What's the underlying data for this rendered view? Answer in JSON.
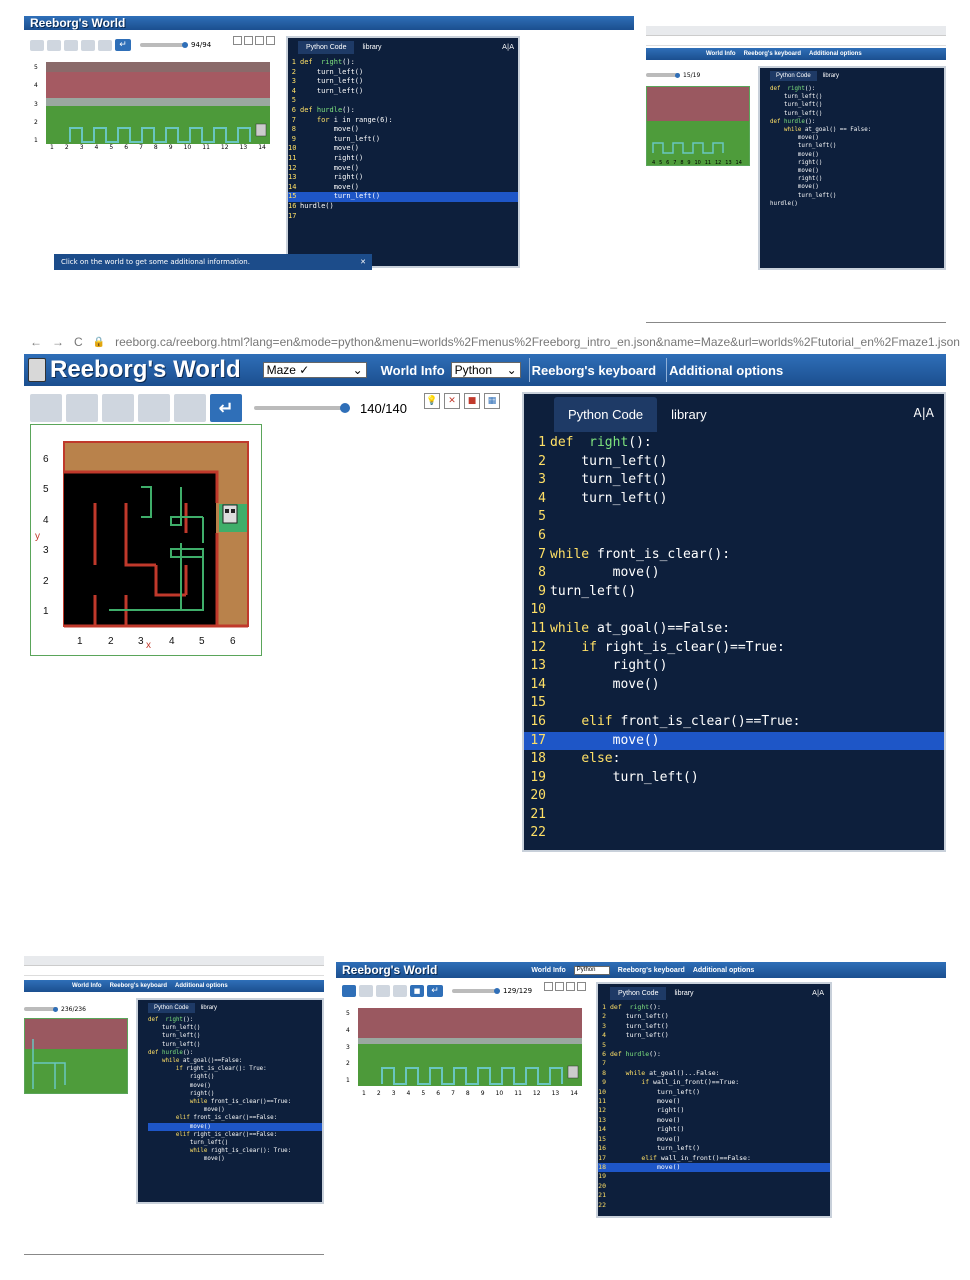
{
  "top_left": {
    "brand": "Reeborg's World",
    "speed_value": "94/94",
    "editor_tabs": [
      "Python Code",
      "library"
    ],
    "font_toggle": "A|A",
    "code": [
      {
        "n": "1",
        "t": "def  right():"
      },
      {
        "n": "2",
        "t": "    turn_left()"
      },
      {
        "n": "3",
        "t": "    turn_left()"
      },
      {
        "n": "4",
        "t": "    turn_left()"
      },
      {
        "n": "5",
        "t": ""
      },
      {
        "n": "6",
        "t": "def hurdle():"
      },
      {
        "n": "7",
        "t": "    for i in range(6):"
      },
      {
        "n": "8",
        "t": "        move()"
      },
      {
        "n": "9",
        "t": "        turn_left()"
      },
      {
        "n": "10",
        "t": "        move()"
      },
      {
        "n": "11",
        "t": "        right()"
      },
      {
        "n": "12",
        "t": "        move()"
      },
      {
        "n": "13",
        "t": "        right()"
      },
      {
        "n": "14",
        "t": "        move()"
      },
      {
        "n": "15",
        "t": "        turn_left()"
      },
      {
        "n": "16",
        "t": "hurdle()"
      },
      {
        "n": "17",
        "t": ""
      }
    ],
    "highlight_line": 15,
    "x_ticks": [
      "1",
      "2",
      "3",
      "4",
      "5",
      "6",
      "7",
      "8",
      "9",
      "10",
      "11",
      "12",
      "13",
      "14"
    ],
    "y_ticks": [
      "5",
      "4",
      "3",
      "2",
      "1"
    ],
    "info_banner": "Click on the world to get some additional information."
  },
  "top_right": {
    "speed_value": "15/19",
    "menu_items": [
      "World Info",
      "Reeborg's keyboard",
      "Additional options"
    ],
    "editor_tabs": [
      "Python Code",
      "library"
    ],
    "code": [
      "def  right():",
      "    turn_left()",
      "    turn_left()",
      "    turn_left()",
      "",
      "def hurdle():",
      "",
      "    while at_goal() == False:",
      "        move()",
      "        turn_left()",
      "        move()",
      "        right()",
      "        move()",
      "        right()",
      "        move()",
      "        turn_left()",
      "hurdle()"
    ],
    "x_ticks": [
      "4",
      "5",
      "6",
      "7",
      "8",
      "9",
      "10",
      "11",
      "12",
      "13",
      "14"
    ]
  },
  "main": {
    "nav_back": "←",
    "nav_forward": "→",
    "nav_reload": "C",
    "url": "reeborg.ca/reeborg.html?lang=en&mode=python&menu=worlds%2Fmenus%2Freeborg_intro_en.json&name=Maze&url=worlds%2Ftutorial_en%2Fmaze1.json",
    "brand": "Reeborg's World",
    "world_select": "Maze ✓",
    "world_info": "World Info",
    "language_select": "Python",
    "keyboard": "Reeborg's keyboard",
    "additional_options": "Additional options",
    "enter_icon": "↵",
    "speed_value": "140/140",
    "tabs": [
      "Python Code",
      "library"
    ],
    "font_toggle": "A|A",
    "x_ticks": [
      "1",
      "2",
      "3",
      "4",
      "5",
      "6"
    ],
    "y_ticks": [
      "6",
      "5",
      "4",
      "3",
      "2",
      "1"
    ],
    "x_axis_label": "x",
    "y_axis_label": "y",
    "code": [
      {
        "n": "1",
        "t": "def  right():"
      },
      {
        "n": "2",
        "t": "    turn_left()"
      },
      {
        "n": "3",
        "t": "    turn_left()"
      },
      {
        "n": "4",
        "t": "    turn_left()"
      },
      {
        "n": "5",
        "t": ""
      },
      {
        "n": "6",
        "t": ""
      },
      {
        "n": "7",
        "t": "while front_is_clear():"
      },
      {
        "n": "8",
        "t": "        move()"
      },
      {
        "n": "9",
        "t": "turn_left()"
      },
      {
        "n": "10",
        "t": ""
      },
      {
        "n": "11",
        "t": "while at_goal()==False:"
      },
      {
        "n": "12",
        "t": "    if right_is_clear()==True:"
      },
      {
        "n": "13",
        "t": "        right()"
      },
      {
        "n": "14",
        "t": "        move()"
      },
      {
        "n": "15",
        "t": ""
      },
      {
        "n": "16",
        "t": "    elif front_is_clear()==True:"
      },
      {
        "n": "17",
        "t": "        move()"
      },
      {
        "n": "18",
        "t": "    else:"
      },
      {
        "n": "19",
        "t": "        turn_left()"
      },
      {
        "n": "20",
        "t": ""
      },
      {
        "n": "21",
        "t": ""
      },
      {
        "n": "22",
        "t": ""
      }
    ],
    "highlight_line": 17
  },
  "bottom_left": {
    "speed_value": "236/236",
    "menu_items": [
      "World Info",
      "Reeborg's keyboard",
      "Additional options"
    ],
    "editor_tabs": [
      "Python Code",
      "library"
    ],
    "code": [
      "def  right():",
      "    turn_left()",
      "    turn_left()",
      "    turn_left()",
      "",
      "def hurdle():",
      "",
      "    while at_goal()==False:",
      "        if right_is_clear(): True:",
      "            right()",
      "            move()",
      "            right()",
      "            while front_is_clear()==True:",
      "                move()",
      "        elif front_is_clear()==False:",
      "            move()",
      "        elif right_is_clear()==False:",
      "            turn_left()",
      "            while right_is_clear(): True:",
      "                move()"
    ],
    "highlight_line": 16
  },
  "bottom_right": {
    "brand": "Reeborg's World",
    "menu_items": [
      "World Info",
      "Python",
      "Reeborg's keyboard",
      "Additional options"
    ],
    "speed_value": "129/129",
    "editor_tabs": [
      "Python Code",
      "library"
    ],
    "font_toggle": "A|A",
    "code": [
      {
        "n": "1",
        "t": "def  right():"
      },
      {
        "n": "2",
        "t": "    turn_left()"
      },
      {
        "n": "3",
        "t": "    turn_left()"
      },
      {
        "n": "4",
        "t": "    turn_left()"
      },
      {
        "n": "5",
        "t": ""
      },
      {
        "n": "6",
        "t": "def hurdle():"
      },
      {
        "n": "7",
        "t": ""
      },
      {
        "n": "8",
        "t": "    while at_goal()...False:"
      },
      {
        "n": "9",
        "t": "        if wall_in_front()==True:"
      },
      {
        "n": "10",
        "t": "            turn_left()"
      },
      {
        "n": "11",
        "t": "            move()"
      },
      {
        "n": "12",
        "t": "            right()"
      },
      {
        "n": "13",
        "t": "            move()"
      },
      {
        "n": "14",
        "t": "            right()"
      },
      {
        "n": "15",
        "t": "            move()"
      },
      {
        "n": "16",
        "t": "            turn_left()"
      },
      {
        "n": "17",
        "t": "        elif wall_in_front()==False:"
      },
      {
        "n": "18",
        "t": "            move()"
      },
      {
        "n": "19",
        "t": ""
      },
      {
        "n": "20",
        "t": ""
      },
      {
        "n": "21",
        "t": ""
      },
      {
        "n": "22",
        "t": ""
      }
    ],
    "highlight_line": 18,
    "x_ticks": [
      "1",
      "2",
      "3",
      "4",
      "5",
      "6",
      "7",
      "8",
      "9",
      "10",
      "11",
      "12",
      "13",
      "14"
    ],
    "y_ticks": [
      "5",
      "4",
      "3",
      "2",
      "1"
    ]
  },
  "colors": {
    "topbar": "#2f6fb8",
    "editor_bg": "#0d1f3c",
    "highlight": "#1e56c7",
    "keyword": "#ffe066",
    "function_name": "#7ee37e",
    "wall": "#c0392b",
    "path": "#3fae6a",
    "sand": "#b9824b"
  }
}
